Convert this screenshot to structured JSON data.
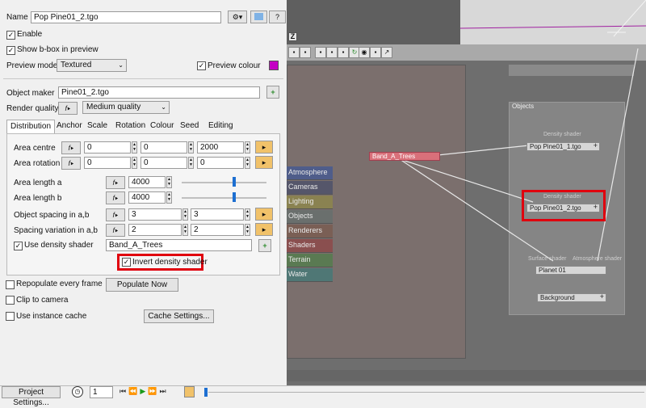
{
  "top": {
    "name_label": "Name",
    "name_value": "Pop Pine01_2.tgo",
    "help_label": "?",
    "enable_label": "Enable",
    "bbox_label": "Show b-box in preview",
    "preview_mode_label": "Preview mode",
    "preview_mode_value": "Textured",
    "preview_colour_label": "Preview colour",
    "preview_colour": "#c400c4"
  },
  "object": {
    "maker_label": "Object maker",
    "maker_value": "Pine01_2.tgo",
    "quality_label": "Render quality",
    "quality_value": "Medium quality"
  },
  "tabs": [
    "Distribution",
    "Anchor",
    "Scale",
    "Rotation",
    "Colour",
    "Seed",
    "Editing"
  ],
  "distribution": {
    "area_centre_label": "Area centre",
    "area_centre": [
      "0",
      "0",
      "2000"
    ],
    "area_rotation_label": "Area rotation",
    "area_rotation": [
      "0",
      "0",
      "0"
    ],
    "length_a_label": "Area length a",
    "length_a": "4000",
    "length_b_label": "Area length b",
    "length_b": "4000",
    "spacing_label": "Object spacing in a,b",
    "spacing": [
      "3",
      "3"
    ],
    "variation_label": "Spacing variation in a,b",
    "variation": [
      "2",
      "2"
    ],
    "density_label": "Use density shader",
    "density_value": "Band_A_Trees",
    "invert_label": "Invert density shader"
  },
  "bottom_opts": {
    "repopulate_label": "Repopulate every frame",
    "populate_label": "Populate Now",
    "clip_label": "Clip to camera",
    "instance_label": "Use instance cache",
    "cache_label": "Cache Settings..."
  },
  "status": {
    "project_label": "Project Settings...",
    "frame_value": "1"
  },
  "categories": [
    {
      "label": "Atmosphere",
      "color": "#4f5d8a"
    },
    {
      "label": "Cameras",
      "color": "#55566a"
    },
    {
      "label": "Lighting",
      "color": "#8a8251"
    },
    {
      "label": "Objects",
      "color": "#6a6f6d"
    },
    {
      "label": "Renderers",
      "color": "#7a5f55"
    },
    {
      "label": "Shaders",
      "color": "#8a4f4f"
    },
    {
      "label": "Terrain",
      "color": "#5a7a52"
    },
    {
      "label": "Water",
      "color": "#4f7775"
    }
  ],
  "network": {
    "objects_title": "Objects",
    "band_node": "Band_A_Trees",
    "pop1_caption": "Density shader",
    "pop1": "Pop Pine01_1.tgo",
    "pop2_caption": "Density shader",
    "pop2": "Pop Pine01_2.tgo",
    "planet_caption_a": "Surface shader",
    "planet_caption_b": "Atmosphere shader",
    "planet": "Planet 01",
    "background": "Background",
    "viewport_icon": "Z"
  }
}
